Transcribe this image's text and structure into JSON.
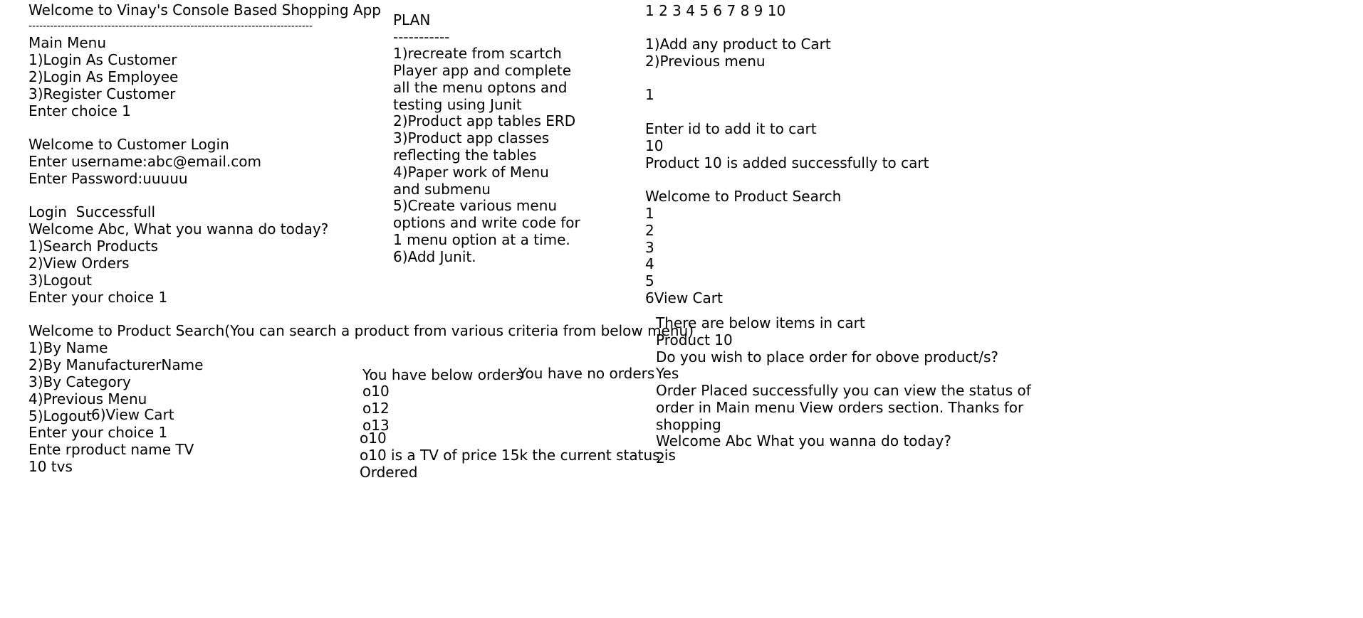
{
  "col1": {
    "title": "Welcome to Vinay's Console Based Shopping App",
    "divider": "-------------------------------------------------------------------------------",
    "main_menu": [
      "Main Menu",
      "1)Login As Customer",
      "2)Login As Employee",
      "3)Register Customer",
      "Enter choice 1"
    ],
    "login": [
      "Welcome to Customer Login",
      "Enter username:abc@email.com",
      "Enter Password:uuuuu"
    ],
    "customer_menu": [
      "Login  Successfull",
      "Welcome Abc, What you wanna do today?",
      "1)Search Products",
      "2)View Orders",
      "3)Logout",
      "Enter your choice 1"
    ],
    "search": [
      "Welcome to Product Search(You can search a product from various criteria from below menu)",
      "1)By Name",
      "2)By ManufacturerName",
      "3)By Category",
      "4)Previous Menu",
      "5)Logout",
      "Enter your choice 1",
      "Ente rproduct name TV",
      "10 tvs"
    ],
    "view_cart_inline": "6)View Cart"
  },
  "plan": {
    "heading": "PLAN",
    "divider": "-----------",
    "lines": [
      "1)recreate from scartch",
      "Player app and complete",
      "all the menu optons and",
      "testing using Junit",
      "2)Product app tables ERD",
      "3)Product app classes",
      "reflecting the tables",
      "4)Paper work of Menu",
      "and submenu",
      "5)Create various menu",
      "options and write code for",
      "1 menu option at a time.",
      "6)Add Junit."
    ]
  },
  "orders": {
    "header": "You have below orders",
    "no_orders": "You have no orders",
    "list": [
      "o10",
      "o12",
      "o13"
    ],
    "selected": "o10",
    "detail": [
      "o10 is a TV of price 15k the current status is",
      "Ordered"
    ]
  },
  "col3": {
    "numbers": "1 2 3 4 5 6 7 8 9 10",
    "menu": [
      "1)Add any product to Cart",
      "2)Previous menu"
    ],
    "choice": "1",
    "add": [
      "Enter id to add it to cart",
      "10",
      "Product 10 is added successfully to cart"
    ],
    "search": [
      "Welcome to Product Search",
      "1",
      "2",
      "3",
      "4",
      "5",
      "6View Cart"
    ]
  },
  "cart": {
    "lines": [
      "There are below items in cart",
      "Product 10",
      "Do you wish to place order for obove product/s?",
      "Yes",
      "Order Placed successfully you can view the status of",
      "order in Main menu View orders section. Thanks for",
      "shopping",
      "Welcome Abc What you wanna do today?",
      "2"
    ]
  }
}
